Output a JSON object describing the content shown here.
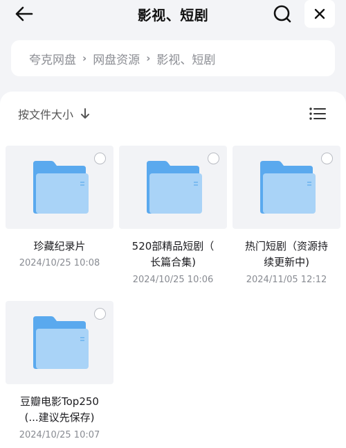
{
  "header": {
    "title": "影视、短剧",
    "back_icon": "back-arrow-icon",
    "search_icon": "search-icon",
    "close_icon": "close-icon"
  },
  "breadcrumb": [
    "夸克网盘",
    "网盘资源",
    "影视、短剧"
  ],
  "toolbar": {
    "sort_label": "按文件大小",
    "sort_icon": "arrow-down-icon",
    "view_icon": "list-view-icon"
  },
  "files": [
    {
      "name_lines": [
        "珍藏纪录片"
      ],
      "date": "2024/10/25 10:08"
    },
    {
      "name_lines": [
        "520部精品短剧（",
        "长篇合集)"
      ],
      "date": "2024/10/25 10:06"
    },
    {
      "name_lines": [
        "热门短剧（资源持",
        "续更新中)"
      ],
      "date": "2024/11/05 12:12"
    },
    {
      "name_lines": [
        "豆瓣电影Top250",
        "(...建议先保存)"
      ],
      "date": "2024/10/25 10:07"
    }
  ],
  "colors": {
    "background": "#f3f4f7",
    "folder_back": "#5aa9ee",
    "folder_front": "#a9d3f7"
  }
}
